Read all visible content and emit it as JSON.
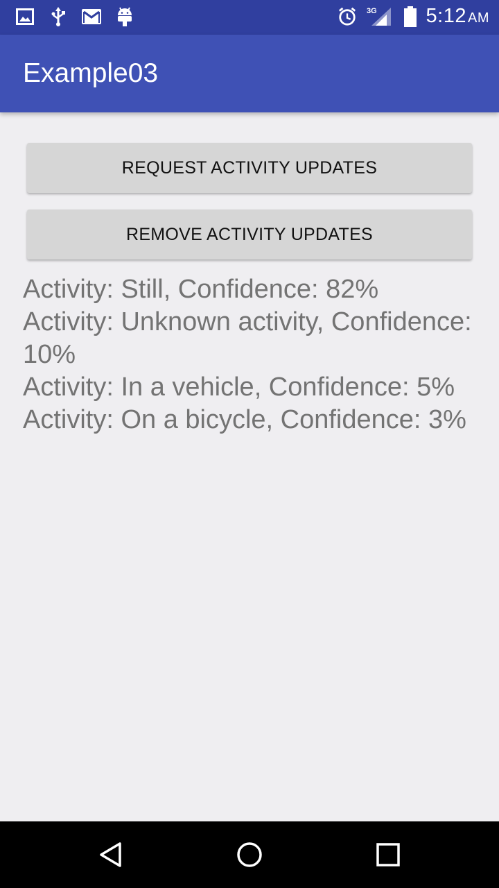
{
  "status_bar": {
    "time": "5:12",
    "ampm": "AM",
    "network": "3G",
    "icons": [
      "image-icon",
      "usb-icon",
      "gmail-icon",
      "android-icon",
      "alarm-icon",
      "signal-icon",
      "battery-icon"
    ]
  },
  "app_bar": {
    "title": "Example03"
  },
  "buttons": {
    "request_label": "REQUEST ACTIVITY UPDATES",
    "remove_label": "REMOVE ACTIVITY UPDATES"
  },
  "activity_text": "Activity: Still, Confidence: 82%\nActivity: Unknown activity, Confidence: 10%\nActivity: In a vehicle, Confidence: 5%\nActivity: On a bicycle, Confidence: 3%",
  "nav_bar": {
    "icons": [
      "back-icon",
      "home-icon",
      "recents-icon"
    ]
  },
  "colors": {
    "status_bar": "#303f9f",
    "app_bar": "#3f51b5",
    "background": "#efeef1",
    "button": "#d6d6d6",
    "text": "#737373"
  }
}
